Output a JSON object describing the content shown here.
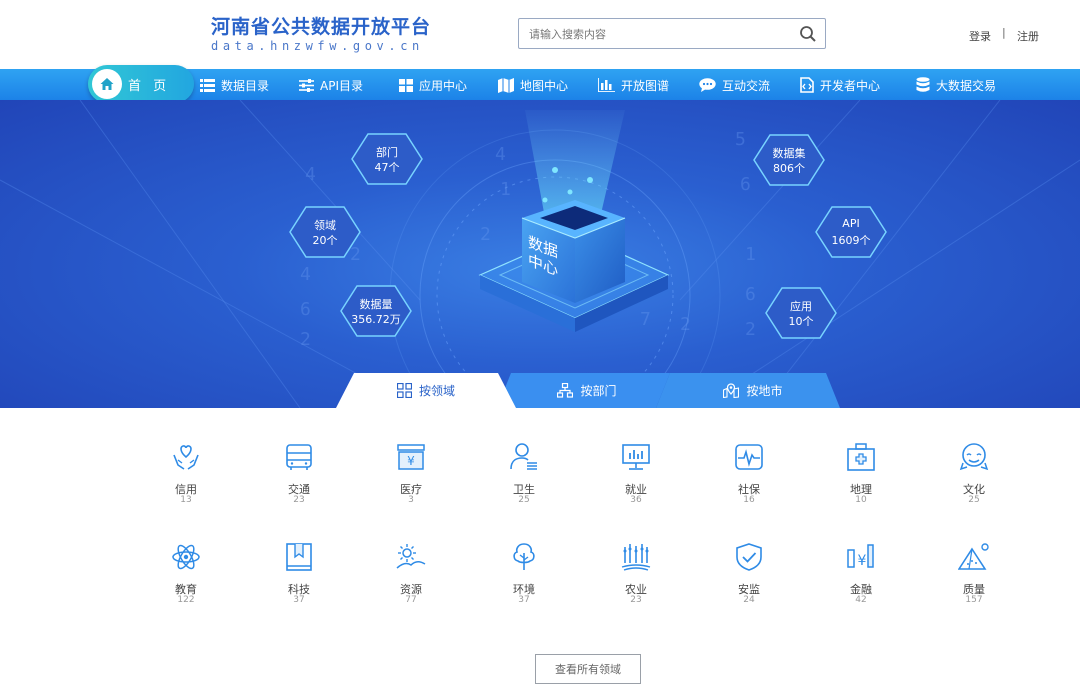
{
  "header": {
    "title": "河南省公共数据开放平台",
    "url": "data.hnzwfw.gov.cn",
    "search_placeholder": "请输入搜索内容",
    "login": "登录",
    "separator": "|",
    "register": "注册"
  },
  "nav": {
    "home": "首 页",
    "items": [
      "数据目录",
      "API目录",
      "应用中心",
      "地图中心",
      "开放图谱",
      "互动交流",
      "开发者中心",
      "大数据交易"
    ]
  },
  "hero": {
    "center_label": "数据中心",
    "stats": [
      {
        "label": "部门",
        "value": "47个"
      },
      {
        "label": "领域",
        "value": "20个"
      },
      {
        "label": "数据量",
        "value": "356.72万"
      },
      {
        "label": "数据集",
        "value": "806个"
      },
      {
        "label": "API",
        "value": "1609个"
      },
      {
        "label": "应用",
        "value": "10个"
      }
    ]
  },
  "tabs": [
    {
      "label": "按领域",
      "icon": "grid-icon",
      "active": true
    },
    {
      "label": "按部门",
      "icon": "org-chart-icon",
      "active": false
    },
    {
      "label": "按地市",
      "icon": "map-pin-icon",
      "active": false
    }
  ],
  "categories": [
    {
      "name": "信用",
      "count": "13",
      "icon": "heart-hands-icon"
    },
    {
      "name": "交通",
      "count": "23",
      "icon": "bus-icon"
    },
    {
      "name": "医疗",
      "count": "3",
      "icon": "medical-cash-icon"
    },
    {
      "name": "卫生",
      "count": "25",
      "icon": "person-list-icon"
    },
    {
      "name": "就业",
      "count": "36",
      "icon": "monitor-chart-icon"
    },
    {
      "name": "社保",
      "count": "16",
      "icon": "pulse-icon"
    },
    {
      "name": "地理",
      "count": "10",
      "icon": "first-aid-kit-icon"
    },
    {
      "name": "文化",
      "count": "25",
      "icon": "culture-mask-icon"
    },
    {
      "name": "教育",
      "count": "122",
      "icon": "atom-icon"
    },
    {
      "name": "科技",
      "count": "37",
      "icon": "book-bookmark-icon"
    },
    {
      "name": "资源",
      "count": "77",
      "icon": "sun-landscape-icon"
    },
    {
      "name": "环境",
      "count": "37",
      "icon": "tree-icon"
    },
    {
      "name": "农业",
      "count": "23",
      "icon": "crops-icon"
    },
    {
      "name": "安监",
      "count": "24",
      "icon": "shield-check-icon"
    },
    {
      "name": "金融",
      "count": "42",
      "icon": "currency-icon"
    },
    {
      "name": "质量",
      "count": "157",
      "icon": "pyramid-icon"
    }
  ],
  "view_all": "查看所有领域",
  "colors": {
    "primary": "#2a63c9",
    "nav": "#1c82e8",
    "icon": "#2f8be6",
    "hero": "#2a5fd0"
  }
}
